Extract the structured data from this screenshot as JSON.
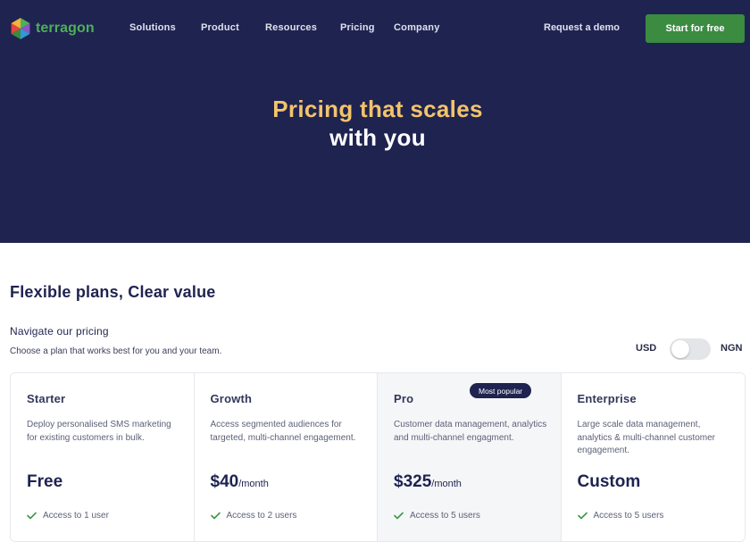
{
  "header": {
    "logo_text": "terragon",
    "nav": [
      {
        "label": "Solutions"
      },
      {
        "label": "Product"
      },
      {
        "label": "Resources"
      },
      {
        "label": "Pricing"
      },
      {
        "label": "Company"
      }
    ],
    "demo_label": "Request a demo",
    "cta_label": "Start for free"
  },
  "hero": {
    "title_line1": "Pricing that scales",
    "title_line2": "with you"
  },
  "pricing": {
    "section_title": "Flexible plans, Clear value",
    "subtitle": "Navigate our pricing",
    "description": "Choose a plan that works best for you and your team.",
    "currency": {
      "left": "USD",
      "right": "NGN",
      "selected": "USD"
    },
    "plans": [
      {
        "name": "Starter",
        "description": "Deploy personalised SMS marketing for existing customers in bulk.",
        "price": "Free",
        "period": "",
        "feature": "Access to 1 user"
      },
      {
        "name": "Growth",
        "description": "Access segmented audiences for targeted, multi-channel engagement.",
        "price": "$40",
        "period": "/month",
        "feature": "Access to 2 users"
      },
      {
        "name": "Pro",
        "badge": "Most popular",
        "description": "Customer data management, analytics and multi-channel engagment.",
        "price": "$325",
        "period": "/month",
        "feature": "Access to 5 users"
      },
      {
        "name": "Enterprise",
        "description": "Large scale data management, analytics & multi-channel customer engagement.",
        "price": "Custom",
        "period": "",
        "feature": "Access to 5 users"
      }
    ]
  },
  "colors": {
    "navy": "#1f2350",
    "accent_yellow": "#f2c46b",
    "brand_green": "#4db05a",
    "cta_green": "#3b8b41",
    "check_green": "#3a9a45"
  },
  "icons": {
    "logo": "terragon-hexagon-logo",
    "feature": "check-icon"
  }
}
